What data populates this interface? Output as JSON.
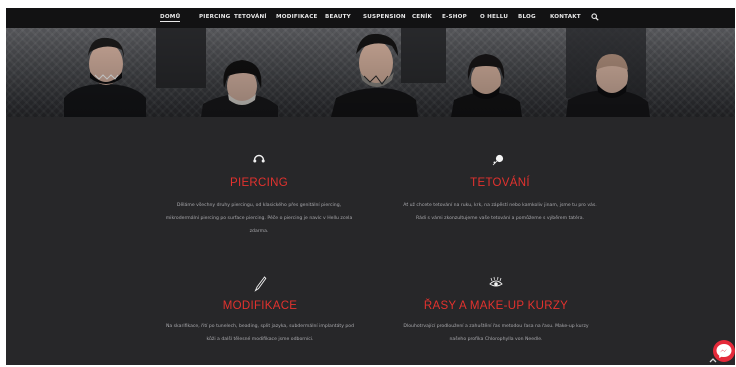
{
  "nav": {
    "items": [
      "DOMŮ",
      "PIERCING",
      "TETOVÁNÍ",
      "MODIFIKACE",
      "BEAUTY",
      "SUSPENSION",
      "CENÍK",
      "E-SHOP",
      "O HELLU",
      "BLOG",
      "KONTAKT"
    ],
    "active_index": 0
  },
  "services": [
    {
      "title": "PIERCING",
      "icon": "headphones-ring-icon",
      "lines": [
        "Děláme všechny druhy piercingu, od klasického přes genitální piercing,",
        "mikrodermální piercing po surface piercing.  Péče o piercing je navíc v  Hellu zcela",
        "zdarma."
      ]
    },
    {
      "title": "TETOVÁNÍ",
      "icon": "tattoo-machine-icon",
      "lines": [
        "Ať už chcete tetování na ruku, krk, na zápěstí nebo kamkoliv jinam, jsme tu pro vás.",
        "Rádi s vámi zkonzultujeme vaše tetování a pomůžeme s výběrem tatéra."
      ]
    },
    {
      "title": "MODIFIKACE",
      "icon": "scalpel-icon",
      "lines": [
        "Na skarifikace, řití po tunelech, beading, split jazyka, subdermální implantáty pod",
        "kůži a další tělesné modifikace jsme odborníci."
      ]
    },
    {
      "title": "ŘASY A MAKE-UP KURZY",
      "icon": "eye-lashes-icon",
      "lines": [
        "Dlouhotrvající prodloužení a zahuštění řas metodou řasa na řasu.  Make-up kurzy",
        "našeho profíka Chlorophylla von  Needle."
      ]
    }
  ],
  "colors": {
    "accent": "#e2322e",
    "nav_bg": "#121213",
    "content_bg": "#272729",
    "chat": "#e52a3a"
  }
}
